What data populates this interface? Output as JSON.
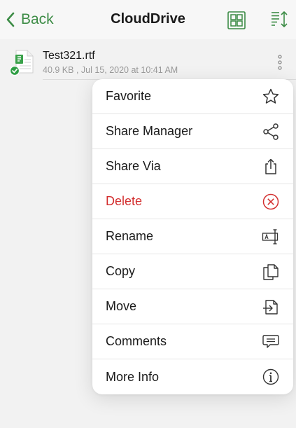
{
  "nav": {
    "back_label": "Back",
    "title": "CloudDrive",
    "accent_color": "#3d8c46"
  },
  "file": {
    "name": "Test321.rtf",
    "meta": "40.9 KB , Jul 15, 2020 at 10:41 AM",
    "status": "synced"
  },
  "menu": {
    "items": [
      {
        "label": "Favorite",
        "icon": "star-icon"
      },
      {
        "label": "Share Manager",
        "icon": "share-nodes-icon"
      },
      {
        "label": "Share Via",
        "icon": "share-upload-icon"
      },
      {
        "label": "Delete",
        "icon": "circle-x-icon",
        "danger": true,
        "color": "#d32f2f"
      },
      {
        "label": "Rename",
        "icon": "rename-icon"
      },
      {
        "label": "Copy",
        "icon": "copy-icon"
      },
      {
        "label": "Move",
        "icon": "move-icon"
      },
      {
        "label": "Comments",
        "icon": "comment-icon"
      },
      {
        "label": "More Info",
        "icon": "info-icon"
      }
    ]
  }
}
